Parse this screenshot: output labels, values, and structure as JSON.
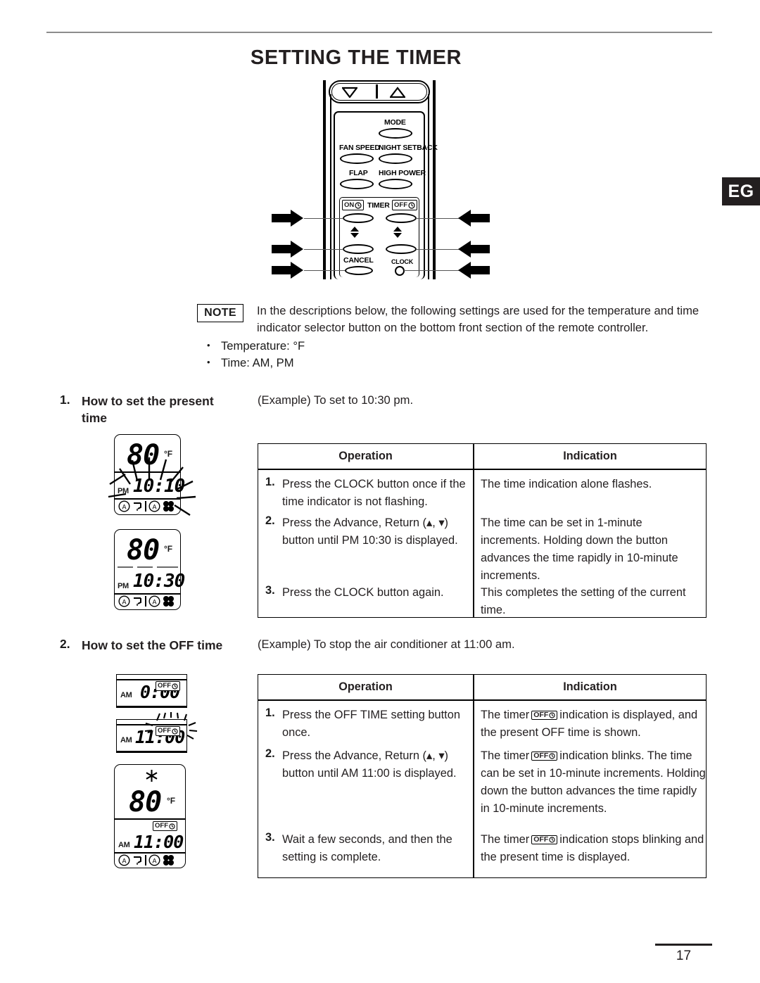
{
  "page": {
    "title": "SETTING THE TIMER",
    "edge_tab": "EG",
    "number": "17"
  },
  "remote": {
    "labels": {
      "mode": "MODE",
      "fan_speed": "FAN SPEED",
      "night_setback": "NIGHT SETBACK",
      "flap": "FLAP",
      "high_power": "HIGH POWER",
      "timer": "TIMER",
      "on": "ON",
      "off": "OFF",
      "cancel": "CANCEL",
      "clock": "CLOCK"
    },
    "icons": {
      "down_triangle": "triangle-down-icon",
      "up_triangle": "triangle-up-icon",
      "clock_face": "clock-face-icon",
      "arrow_right": "arrow-right-icon",
      "arrow_left": "arrow-left-icon"
    }
  },
  "note": {
    "badge": "NOTE",
    "body": "In the descriptions below, the following settings are used for the temperature and time indicator selector button on the bottom front section of the remote controller.",
    "bullets": [
      "Temperature: °F",
      "Time: AM, PM"
    ]
  },
  "sections": [
    {
      "number": "1.",
      "heading": "How to set the present time",
      "example": "(Example) To set to 10:30 pm.",
      "displays": [
        {
          "name": "lcd-present-time-flashing",
          "temperature": "80",
          "unit": "°F",
          "ampm": "PM",
          "time": "10:10",
          "flashing": true,
          "snowflake": false,
          "timer_badge": "",
          "icon_row": [
            "auto-icon",
            "flap-icon",
            "auto-icon",
            "fan-icon"
          ]
        },
        {
          "name": "lcd-present-time-set",
          "temperature": "80",
          "unit": "°F",
          "ampm": "PM",
          "time": "10:30",
          "flashing": false,
          "snowflake": false,
          "timer_badge": "",
          "icon_row": [
            "auto-icon",
            "flap-icon",
            "auto-icon",
            "fan-icon"
          ]
        }
      ],
      "table": {
        "headers": [
          "Operation",
          "Indication"
        ],
        "rows": [
          {
            "num": "1.",
            "operation": "Press the CLOCK button once if the time indicator is not flashing.",
            "indication": "The time indication alone flashes."
          },
          {
            "num": "2.",
            "operation": "Press the Advance, Return (▴, ▾) button until PM 10:30 is displayed.",
            "indication": "The time can be set in 1-minute increments. Holding down the button advances the time rapidly in 10-minute increments."
          },
          {
            "num": "3.",
            "operation": "Press the CLOCK button again.",
            "indication": "This completes the setting of the current time."
          }
        ]
      }
    },
    {
      "number": "2.",
      "heading": "How to set the OFF time",
      "example": "(Example) To stop the air conditioner at 11:00 am.",
      "displays": [
        {
          "name": "lcd-off-time-initial",
          "temperature": "",
          "unit": "",
          "ampm": "AM",
          "time": "0:00",
          "flashing": false,
          "snowflake": false,
          "timer_badge": "OFF",
          "icon_row": []
        },
        {
          "name": "lcd-off-time-blinking",
          "temperature": "",
          "unit": "",
          "ampm": "AM",
          "time": "11:00",
          "flashing": true,
          "snowflake": false,
          "timer_badge": "OFF",
          "icon_row": []
        },
        {
          "name": "lcd-off-time-complete",
          "temperature": "80",
          "unit": "°F",
          "ampm": "AM",
          "time": "11:00",
          "flashing": false,
          "snowflake": true,
          "timer_badge": "OFF",
          "icon_row": [
            "auto-icon",
            "flap-icon",
            "auto-icon",
            "fan-icon"
          ]
        }
      ],
      "table": {
        "headers": [
          "Operation",
          "Indication"
        ],
        "rows": [
          {
            "num": "1.",
            "operation": "Press the OFF TIME setting button once.",
            "indication_pre": "The timer",
            "indication_post": "indication is displayed, and the present OFF time is shown."
          },
          {
            "num": "2.",
            "operation": "Press the Advance, Return (▴, ▾) button until AM 11:00 is displayed.",
            "indication_pre": "The timer",
            "indication_post": "indication blinks. The time can be set in 10-minute increments. Holding down the button advances the time rapidly in 10-minute increments."
          },
          {
            "num": "3.",
            "operation": "Wait a few seconds, and then the setting is complete.",
            "indication_pre": "The timer",
            "indication_post": "indication stops blinking and the present time is displayed."
          }
        ],
        "badge_label": "OFF"
      }
    }
  ]
}
